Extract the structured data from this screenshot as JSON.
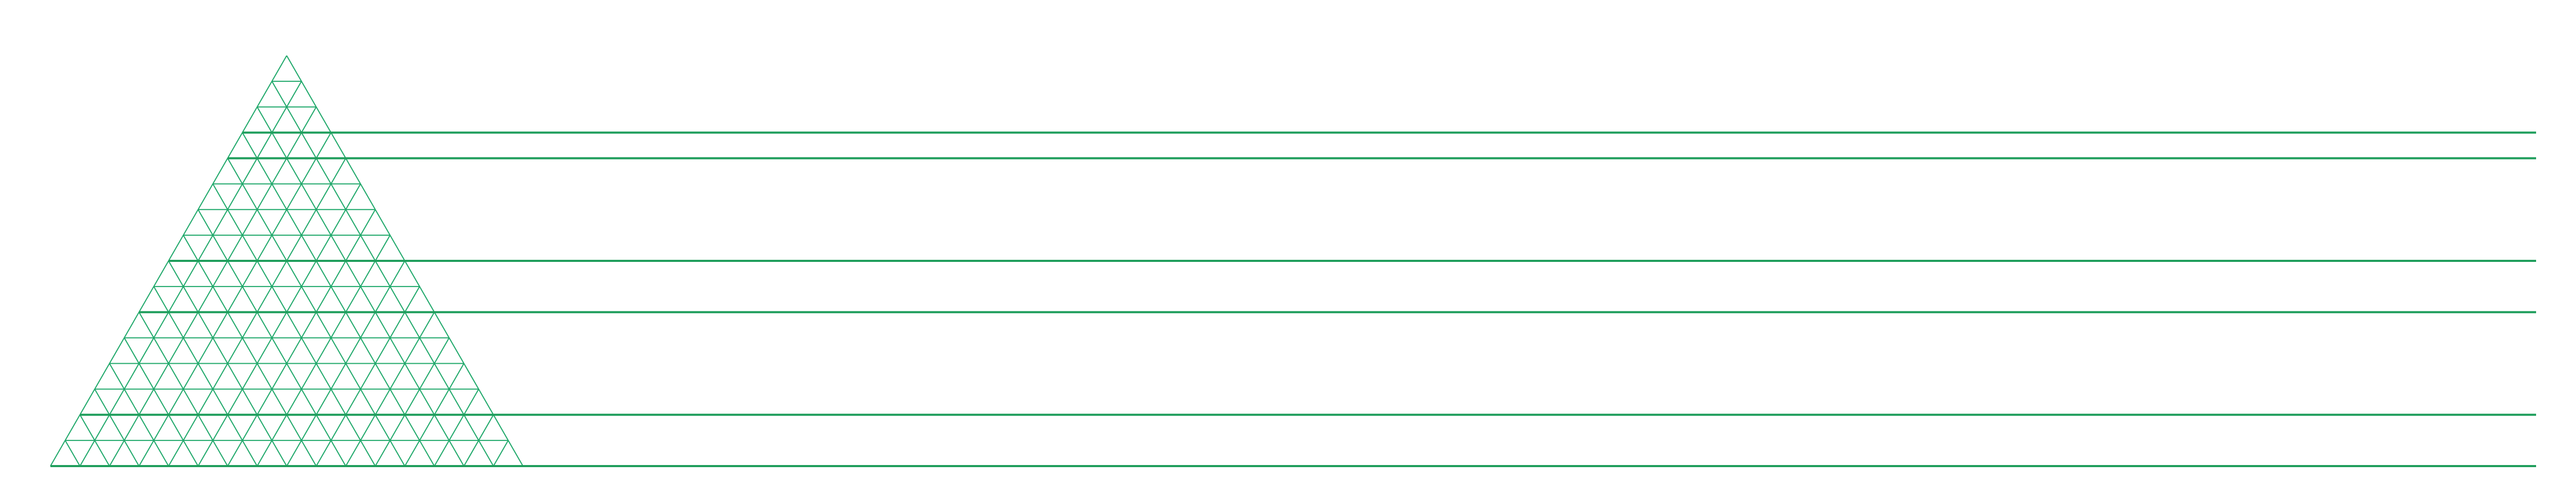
{
  "diagram": {
    "type": "triangular-grid-with-horizontal-guide-lines",
    "colors": {
      "background": "#ffffff",
      "grid_stroke": "#1fa86a",
      "guide_stroke": "#1f9e5c"
    },
    "triangle": {
      "subdivisions": 16
    },
    "guide_lines": [
      {
        "id": "guide-1",
        "grid_row": 3
      },
      {
        "id": "guide-2",
        "grid_row": 4
      },
      {
        "id": "guide-3",
        "grid_row": 8
      },
      {
        "id": "guide-4",
        "grid_row": 10
      },
      {
        "id": "guide-5",
        "grid_row": 14
      },
      {
        "id": "guide-6",
        "grid_row": 16
      }
    ]
  }
}
